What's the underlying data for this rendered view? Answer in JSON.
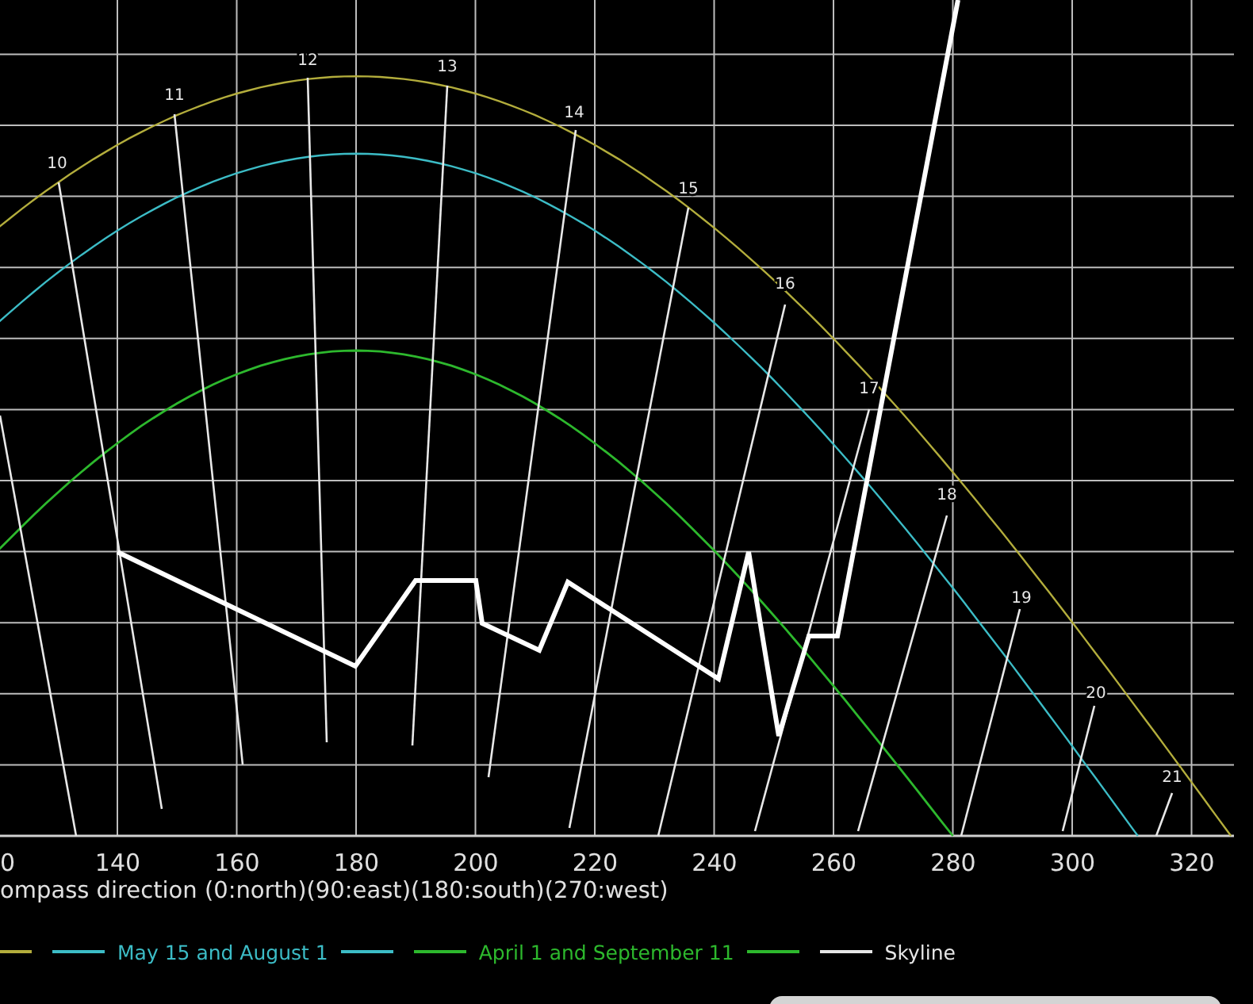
{
  "chart": {
    "hour_labels": [
      "10",
      "11",
      "12",
      "13",
      "14",
      "15",
      "16",
      "17",
      "18",
      "19",
      "20",
      "21"
    ],
    "x_tick_labels": [
      "0",
      "140",
      "160",
      "180",
      "200",
      "220",
      "240",
      "260",
      "280",
      "300",
      "320"
    ],
    "x_axis_title": "ompass direction (0:north)(90:east)(180:south)(270:west)"
  },
  "legend": [
    {
      "kind": "line-only",
      "color": "#b3ad3c"
    },
    {
      "kind": "entry",
      "label": "May 15 and August 1",
      "color": "#3cbcc6"
    },
    {
      "kind": "entry",
      "label": "April 1 and September 11",
      "color": "#2db82d"
    },
    {
      "kind": "entry",
      "label": "Skyline",
      "color": "#e6e6e6"
    }
  ]
}
